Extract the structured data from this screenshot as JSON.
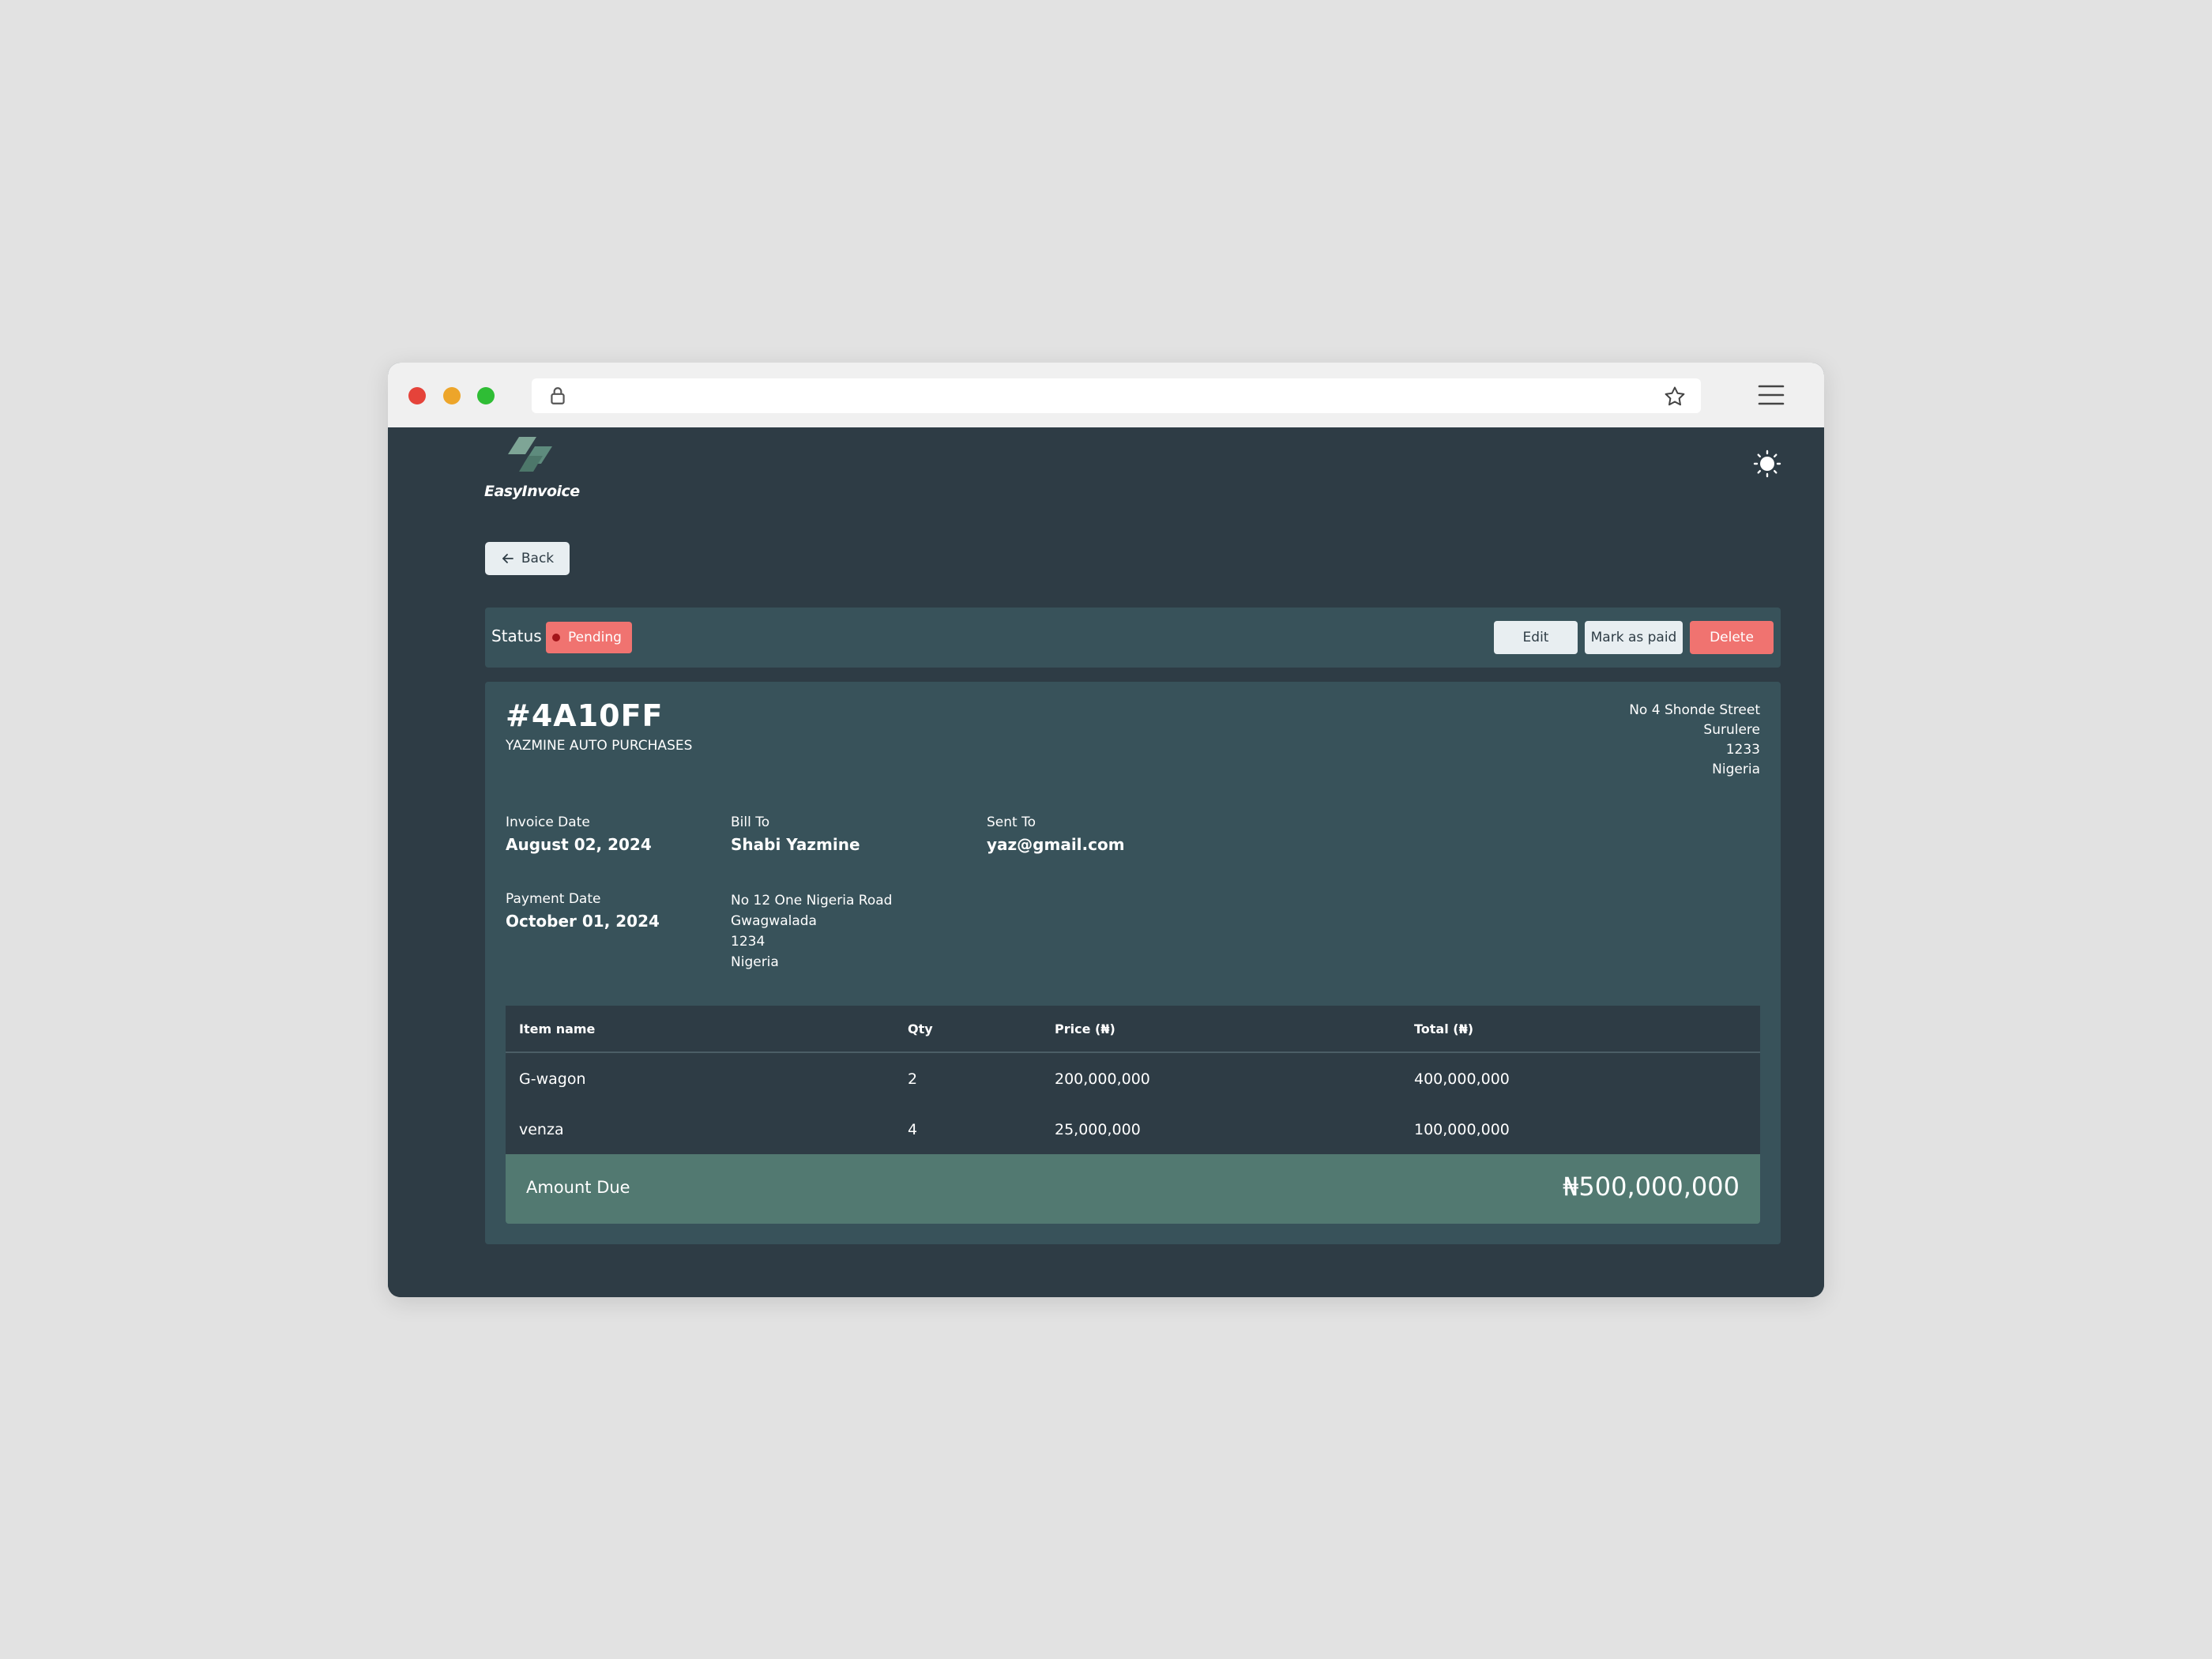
{
  "app": {
    "name": "EasyInvoice"
  },
  "nav": {
    "back_label": "Back"
  },
  "status": {
    "label": "Status",
    "value": "Pending",
    "color": "#f07370"
  },
  "actions": {
    "edit_label": "Edit",
    "mark_paid_label": "Mark as paid",
    "delete_label": "Delete"
  },
  "invoice": {
    "id": "#4A10FF",
    "description": "YAZMINE AUTO PURCHASES",
    "sender_address": {
      "street": "No 4 Shonde Street",
      "city": "Surulere",
      "post_code": "1233",
      "country": "Nigeria"
    },
    "invoice_date_label": "Invoice Date",
    "invoice_date": "August 02, 2024",
    "payment_date_label": "Payment Date",
    "payment_date": "October 01, 2024",
    "bill_to_label": "Bill To",
    "client_name": "Shabi Yazmine",
    "client_address": {
      "street": "No 12 One Nigeria Road",
      "city": "Gwagwalada",
      "post_code": "1234",
      "country": "Nigeria"
    },
    "sent_to_label": "Sent To",
    "client_email": "yaz@gmail.com"
  },
  "table": {
    "headers": {
      "name": "Item name",
      "qty": "Qty",
      "price": "Price (₦)",
      "total": "Total (₦)"
    },
    "rows": [
      {
        "name": "G-wagon",
        "qty": "2",
        "price": "200,000,000",
        "total": "400,000,000"
      },
      {
        "name": "venza",
        "qty": "4",
        "price": "25,000,000",
        "total": "100,000,000"
      }
    ]
  },
  "amount_due": {
    "label": "Amount Due",
    "value": "₦500,000,000"
  },
  "colors": {
    "background": "#2e3c45",
    "card": "#38525a",
    "accent": "#527971",
    "danger": "#f07370"
  }
}
